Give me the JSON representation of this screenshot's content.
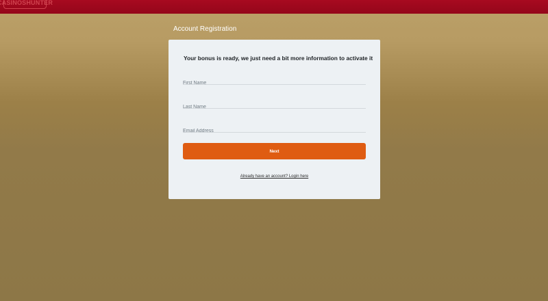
{
  "header": {
    "logo_text": "CASINOSHUNTER",
    "brand_color": "#a0081d"
  },
  "page": {
    "title": "Account Registration"
  },
  "form": {
    "heading": "Your bonus is ready, we just need a bit more information to activate it",
    "fields": [
      {
        "placeholder": "First Name",
        "value": ""
      },
      {
        "placeholder": "Last Name",
        "value": ""
      },
      {
        "placeholder": "Email Address",
        "value": ""
      }
    ],
    "next_label": "Next",
    "accent_color": "#df5c12",
    "login_link_text": "Already have an account? Login here"
  }
}
